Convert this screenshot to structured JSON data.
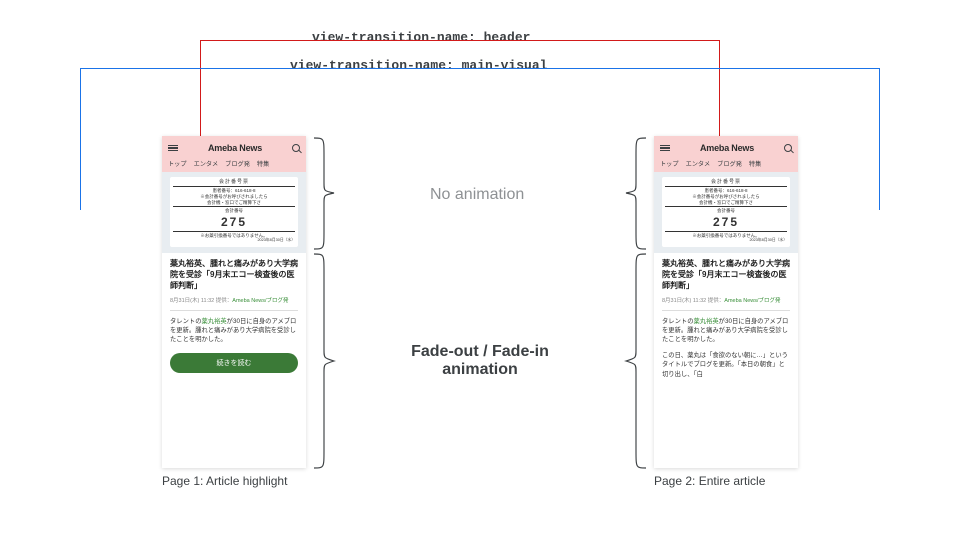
{
  "labels": {
    "header_transition": "view-transition-name: header",
    "visual_transition": "view-transition-name: main-visual"
  },
  "annotations": {
    "no_animation": "No animation",
    "fade": "Fade-out / Fade-in animation"
  },
  "captions": {
    "page1": "Page 1: Article highlight",
    "page2": "Page 2: Entire article"
  },
  "app": {
    "logo": "Ameba News",
    "nav": [
      "トップ",
      "エンタメ",
      "ブログ発",
      "特集"
    ]
  },
  "ticket": {
    "title": "会計番号票",
    "code_label": "患者番号：",
    "code": "616-618-8",
    "note1": "※会計番号がお呼びされましたら",
    "note2": "会計機・窓口でご精算下さ",
    "subheading": "会計番号",
    "number": "275",
    "footnote": "※お薬引換番号ではありません。",
    "date": "2023年8月30日（水）"
  },
  "article": {
    "headline": "薬丸裕英、腫れと痛みがあり大学病院を受診「9月末エコー検査後の医師判断」",
    "meta_time": "8月31日(木) 11:32",
    "meta_prov": "提供：",
    "meta_source": "Ameba News/ブログ発",
    "body_prefix": "タレントの",
    "body_link": "薬丸裕英",
    "body_rest": "が30日に自身のアメブロを更新。腫れと痛みがあり大学病院を受診したことを明かした。",
    "body2": "この日、薬丸は「食欲のない朝に…」というタイトルでブログを更新。「本日の朝食」と切り出し、「白",
    "cta": "続きを読む"
  }
}
